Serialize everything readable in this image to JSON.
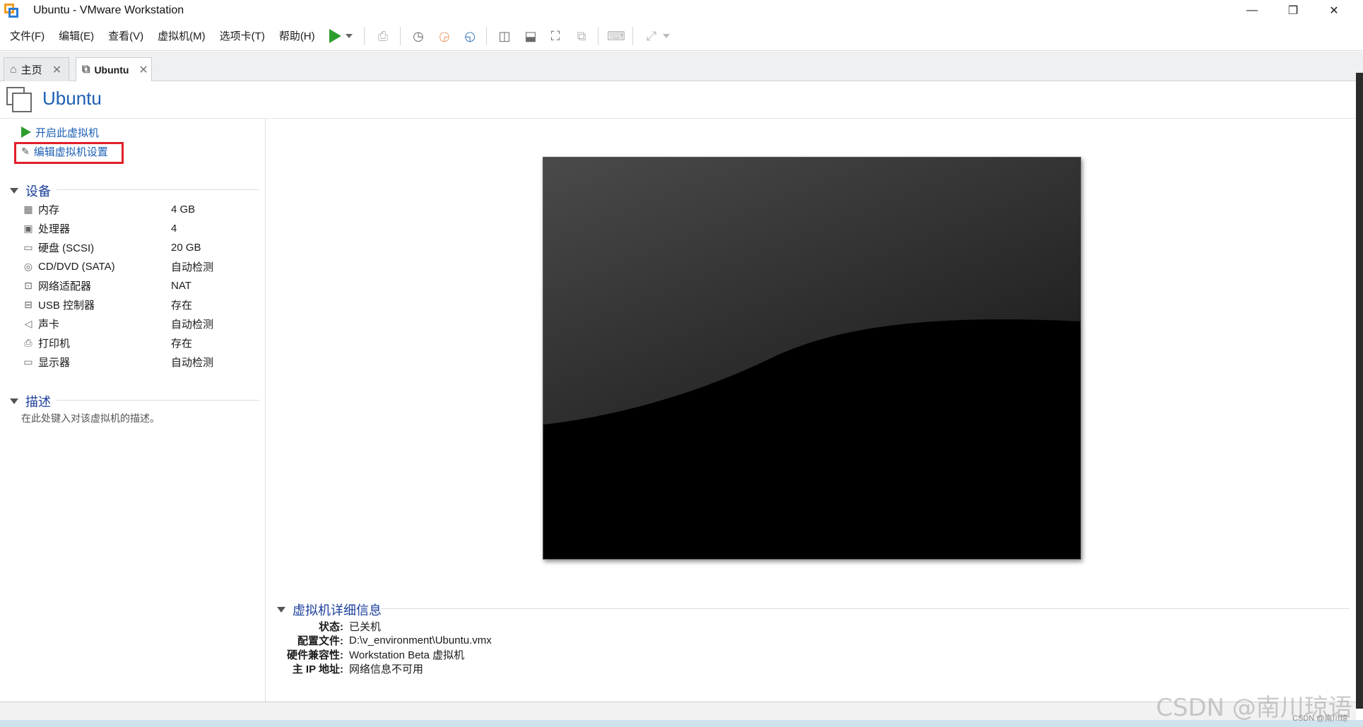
{
  "window": {
    "title": "Ubuntu - VMware Workstation",
    "minimize": "—",
    "restore": "❐",
    "close": "✕"
  },
  "menu": {
    "items": [
      "文件(F)",
      "编辑(E)",
      "查看(V)",
      "虚拟机(M)",
      "选项卡(T)",
      "帮助(H)"
    ]
  },
  "toolbar": {
    "icons": [
      "power-on-icon",
      "dropdown-icon",
      "send-keys-icon",
      "snapshot-icon",
      "revert-snapshot-icon",
      "snapshot-manager-icon",
      "library-view-icon",
      "thumbnail-view-icon",
      "full-screen-icon",
      "unity-icon",
      "console-icon",
      "stretch-icon"
    ]
  },
  "tabs": [
    {
      "label": "主页",
      "icon": "home-icon",
      "close": "✕"
    },
    {
      "label": "Ubuntu",
      "icon": "vm-icon",
      "close": "✕"
    }
  ],
  "vm": {
    "name": "Ubuntu"
  },
  "actions": {
    "power_on": "开启此虚拟机",
    "edit_settings": "编辑虚拟机设置"
  },
  "devices": {
    "heading": "设备",
    "items": [
      {
        "name": "内存",
        "value": "4 GB",
        "icon": "memory-icon"
      },
      {
        "name": "处理器",
        "value": "4",
        "icon": "cpu-icon"
      },
      {
        "name": "硬盘 (SCSI)",
        "value": "20 GB",
        "icon": "hard-disk-icon"
      },
      {
        "name": "CD/DVD (SATA)",
        "value": "自动检测",
        "icon": "cd-icon"
      },
      {
        "name": "网络适配器",
        "value": "NAT",
        "icon": "network-icon"
      },
      {
        "name": "USB 控制器",
        "value": "存在",
        "icon": "usb-icon"
      },
      {
        "name": "声卡",
        "value": "自动检测",
        "icon": "speaker-icon"
      },
      {
        "name": "打印机",
        "value": "存在",
        "icon": "printer-icon"
      },
      {
        "name": "显示器",
        "value": "自动检测",
        "icon": "display-icon"
      }
    ]
  },
  "description": {
    "heading": "描述",
    "placeholder": "在此处键入对该虚拟机的描述。"
  },
  "details": {
    "heading": "虚拟机详细信息",
    "rows": [
      {
        "label": "状态:",
        "value": "已关机"
      },
      {
        "label": "配置文件:",
        "value": "D:\\v_environment\\Ubuntu.vmx"
      },
      {
        "label": "硬件兼容性:",
        "value": "Workstation Beta 虚拟机"
      },
      {
        "label": "主 IP 地址:",
        "value": "网络信息不可用"
      }
    ]
  },
  "watermark": {
    "text": "CSDN @南川琼语",
    "small": "CSDN @南川琼"
  }
}
